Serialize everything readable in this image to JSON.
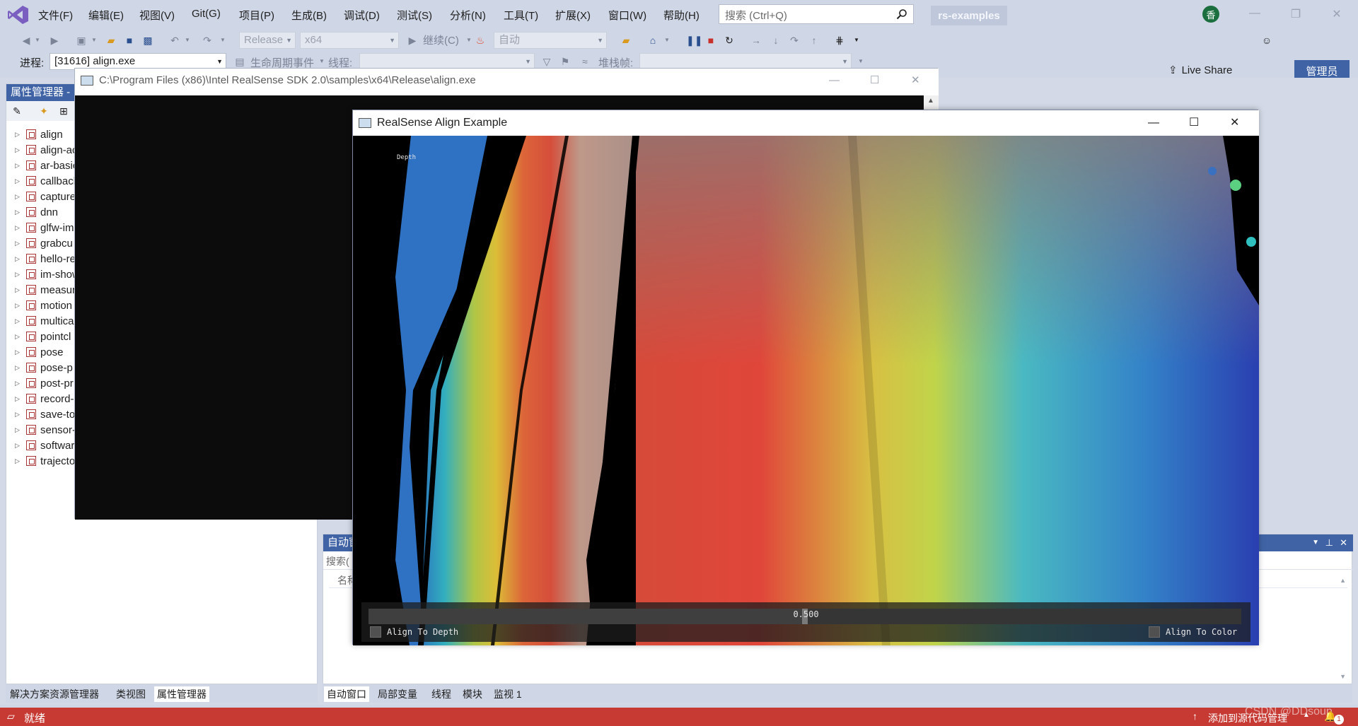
{
  "menu": [
    "文件(F)",
    "编辑(E)",
    "视图(V)",
    "Git(G)",
    "项目(P)",
    "生成(B)",
    "调试(D)",
    "测试(S)",
    "分析(N)",
    "工具(T)",
    "扩展(X)",
    "窗口(W)",
    "帮助(H)"
  ],
  "search": {
    "placeholder": "搜索 (Ctrl+Q)"
  },
  "solution_name": "rs-examples",
  "account_initial": "香",
  "toolbar": {
    "config": "Release",
    "platform": "x64",
    "continue_label": "继续(C)",
    "auto_combo": "自动",
    "live_share": "Live Share",
    "admin": "管理员"
  },
  "debug_location": {
    "process_label": "进程:",
    "process_value": "[31616] align.exe",
    "lifecycle": "生命周期事件",
    "thread_label": "线程:",
    "stack_label": "堆栈帧:"
  },
  "property_panel": {
    "title": "属性管理器 -",
    "items": [
      "align",
      "align-ac",
      "ar-basic",
      "callback",
      "capture",
      "dnn",
      "glfw-im",
      "grabcu",
      "hello-re",
      "im-show",
      "measur",
      "motion",
      "multica",
      "pointcl",
      "pose",
      "pose-p",
      "post-pr",
      "record-",
      "save-to",
      "sensor-",
      "softwar",
      "trajecto"
    ]
  },
  "left_tabs": [
    "解决方案资源管理器",
    "类视图",
    "属性管理器"
  ],
  "auto_panel": {
    "title": "自动窗",
    "search": "搜索(",
    "name_col": "名称"
  },
  "bottom_tabs": [
    "自动窗口",
    "局部变量",
    "线程",
    "模块",
    "监视 1"
  ],
  "console": {
    "title": "C:\\Program Files (x86)\\Intel RealSense SDK 2.0\\samples\\x64\\Release\\align.exe"
  },
  "realsense": {
    "title": "RealSense Align Example",
    "depth_label": "Depth",
    "slider_value": "0.500",
    "slider_fraction": 0.5,
    "align_to_depth": "Align To Depth",
    "align_to_color": "Align To Color"
  },
  "status": {
    "ready": "就绪",
    "source_control": "添加到源代码管理",
    "watermark": "CSDN @DDsoup",
    "notif_count": "1"
  }
}
